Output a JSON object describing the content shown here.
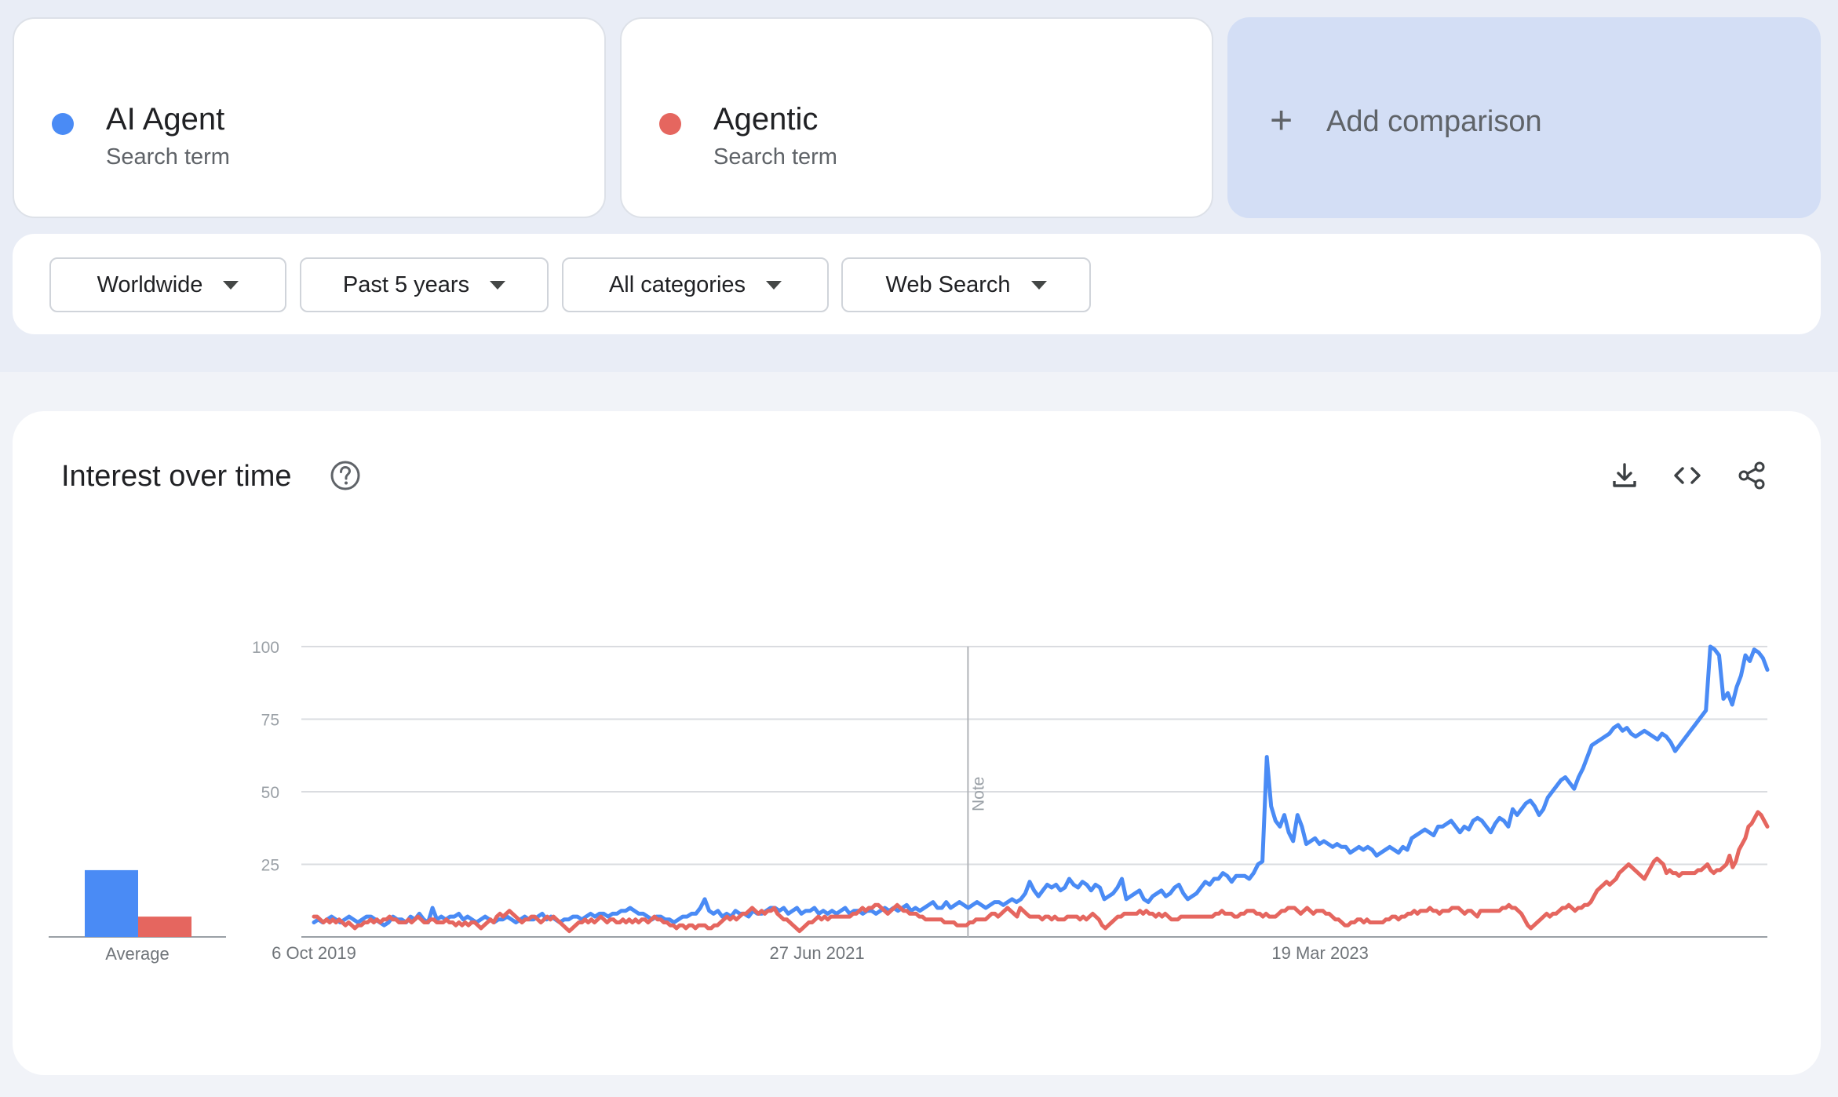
{
  "search_terms": [
    {
      "name": "AI Agent",
      "subtitle": "Search term",
      "color": "#4a8bf5"
    },
    {
      "name": "Agentic",
      "subtitle": "Search term",
      "color": "#e5665f"
    }
  ],
  "add_comparison": {
    "icon": "plus-icon",
    "label": "Add comparison"
  },
  "filters": {
    "region": "Worldwide",
    "time_range": "Past 5 years",
    "category": "All categories",
    "search_type": "Web Search"
  },
  "panel": {
    "title": "Interest over time",
    "help_icon": "help-circle-icon",
    "toolbar_icons": [
      "download-icon",
      "embed-code-icon",
      "share-icon"
    ]
  },
  "chart_data": {
    "type": "line",
    "ylim": [
      0,
      100
    ],
    "y_ticks": [
      "25",
      "50",
      "75",
      "100"
    ],
    "x_tick_labels": [
      "6 Oct 2019",
      "27 Jun 2021",
      "19 Mar 2023"
    ],
    "note_label": "Note",
    "average": {
      "label": "Average",
      "values": [
        {
          "series": "AI Agent",
          "value": 23
        },
        {
          "series": "Agentic",
          "value": 7
        }
      ]
    },
    "weeks": 261,
    "series": [
      {
        "name": "AI Agent",
        "color": "#4a8bf5",
        "values": [
          5,
          6,
          5,
          6,
          7,
          6,
          5,
          6,
          7,
          6,
          5,
          6,
          7,
          7,
          6,
          5,
          4,
          5,
          7,
          6,
          6,
          5,
          7,
          6,
          8,
          6,
          5,
          10,
          6,
          7,
          6,
          7,
          7,
          8,
          6,
          7,
          6,
          5,
          6,
          7,
          6,
          5,
          6,
          6,
          7,
          6,
          5,
          6,
          7,
          6,
          6,
          7,
          8,
          6,
          7,
          6,
          5,
          6,
          6,
          7,
          7,
          6,
          7,
          8,
          7,
          8,
          8,
          7,
          8,
          8,
          9,
          9,
          10,
          9,
          8,
          8,
          7,
          6,
          7,
          7,
          6,
          6,
          5,
          6,
          7,
          7,
          8,
          8,
          10,
          13,
          9,
          8,
          9,
          7,
          8,
          7,
          9,
          8,
          8,
          7,
          9,
          8,
          8,
          9,
          10,
          10,
          9,
          10,
          8,
          9,
          10,
          8,
          9,
          9,
          10,
          8,
          9,
          8,
          9,
          8,
          9,
          10,
          8,
          9,
          9,
          8,
          9,
          9,
          8,
          9,
          10,
          9,
          10,
          9,
          10,
          11,
          9,
          10,
          9,
          10,
          11,
          12,
          10,
          10,
          12,
          10,
          11,
          12,
          11,
          10,
          11,
          12,
          11,
          10,
          11,
          12,
          12,
          11,
          12,
          13,
          12,
          13,
          15,
          19,
          16,
          14,
          16,
          18,
          17,
          18,
          16,
          17,
          20,
          18,
          17,
          19,
          18,
          16,
          18,
          17,
          13,
          14,
          15,
          17,
          20,
          13,
          14,
          15,
          16,
          13,
          12,
          14,
          15,
          16,
          14,
          15,
          17,
          18,
          15,
          13,
          14,
          15,
          17,
          19,
          18,
          20,
          20,
          22,
          21,
          19,
          21,
          21,
          21,
          20,
          22,
          25,
          26,
          62,
          45,
          40,
          38,
          42,
          36,
          33,
          42,
          38,
          32,
          33,
          34,
          32,
          33,
          32,
          31,
          32,
          31,
          31,
          29,
          30,
          31,
          30,
          31,
          30,
          28,
          29,
          30,
          31,
          30,
          29,
          31,
          30,
          34,
          35,
          36,
          37,
          36,
          35,
          38,
          38,
          39,
          40,
          38,
          36,
          38,
          37,
          40,
          41,
          40,
          38,
          36,
          39,
          41,
          40,
          38,
          44,
          42,
          44,
          46,
          47,
          45,
          42,
          44,
          48,
          50,
          52,
          54,
          55,
          53,
          51,
          55,
          58,
          62,
          66,
          67,
          68,
          69,
          70,
          72,
          73,
          71,
          72,
          70,
          69,
          70,
          71,
          70,
          69,
          68,
          70,
          69,
          67,
          64,
          66,
          68,
          70,
          72,
          74,
          76,
          78,
          100,
          99,
          97,
          82,
          84,
          80,
          86,
          90,
          97,
          95,
          99,
          98,
          96,
          92
        ]
      },
      {
        "name": "Agentic",
        "color": "#e5665f",
        "values": [
          7,
          7,
          6,
          5,
          6,
          5,
          6,
          5,
          6,
          5,
          4,
          5,
          4,
          3,
          4,
          4,
          5,
          5,
          6,
          5,
          6,
          5,
          6,
          6,
          7,
          6,
          6,
          5,
          5,
          5,
          6,
          5,
          6,
          7,
          6,
          5,
          5,
          6,
          6,
          5,
          5,
          5,
          6,
          5,
          5,
          4,
          5,
          4,
          5,
          4,
          5,
          5,
          4,
          3,
          4,
          5,
          6,
          5,
          7,
          8,
          7,
          8,
          9,
          8,
          7,
          6,
          5,
          6,
          6,
          7,
          7,
          6,
          5,
          6,
          7,
          6,
          7,
          6,
          5,
          4,
          3,
          2,
          3,
          4,
          5,
          5,
          6,
          5,
          6,
          5,
          6,
          7,
          6,
          5,
          6,
          6,
          5,
          5,
          6,
          5,
          6,
          5,
          6,
          5,
          6,
          6,
          5,
          6,
          7,
          6,
          6,
          5,
          5,
          4,
          4,
          3,
          4,
          4,
          3,
          4,
          4,
          3,
          4,
          4,
          4,
          3,
          3,
          4,
          4,
          5,
          6,
          7,
          6,
          7,
          6,
          7,
          8,
          8,
          9,
          10,
          9,
          8,
          9,
          8,
          9,
          9,
          10,
          8,
          7,
          6,
          6,
          5,
          4,
          3,
          2,
          3,
          4,
          5,
          5,
          6,
          7,
          6,
          7,
          6,
          7,
          7,
          7,
          7,
          7,
          7,
          7,
          8,
          8,
          9,
          10,
          9,
          10,
          10,
          11,
          11,
          10,
          9,
          8,
          9,
          10,
          11,
          10,
          9,
          9,
          8,
          8,
          8,
          7,
          7,
          6,
          6,
          6,
          6,
          6,
          6,
          5,
          5,
          5,
          5,
          4,
          4,
          4,
          4,
          5,
          5,
          6,
          6,
          6,
          6,
          7,
          8,
          8,
          7,
          8,
          9,
          10,
          9,
          8,
          7,
          10,
          9,
          8,
          7,
          7,
          7,
          7,
          6,
          7,
          7,
          6,
          7,
          6,
          6,
          6,
          7,
          7,
          7,
          7,
          6,
          7,
          6,
          7,
          8,
          7,
          6,
          4,
          3,
          4,
          5,
          6,
          7,
          7,
          8,
          8,
          8,
          8,
          8,
          9,
          8,
          9,
          8,
          8,
          7,
          8,
          7,
          8,
          7,
          6,
          6,
          6,
          7,
          7,
          7,
          7,
          7,
          7,
          7,
          7,
          7,
          7,
          7,
          8,
          8,
          9,
          8,
          8,
          8,
          7,
          7,
          8,
          8,
          9,
          9,
          9,
          8,
          8,
          7,
          8,
          7,
          7,
          7,
          8,
          9,
          9,
          10,
          10,
          10,
          9,
          8,
          9,
          10,
          9,
          8,
          9,
          9,
          9,
          8,
          8,
          7,
          6,
          6,
          5,
          4,
          4,
          5,
          5,
          6,
          6,
          5,
          6,
          5,
          5,
          5,
          5,
          5,
          6,
          6,
          7,
          7,
          6,
          7,
          7,
          8,
          8,
          9,
          8,
          9,
          9,
          9,
          10,
          9,
          9,
          8,
          9,
          9,
          9,
          10,
          10,
          10,
          9,
          8,
          9,
          9,
          8,
          7,
          9,
          9,
          9,
          9,
          9,
          9,
          9,
          10,
          10,
          11,
          10,
          10,
          9,
          8,
          6,
          4,
          3,
          4,
          5,
          6,
          7,
          8,
          7,
          8,
          8,
          9,
          10,
          10,
          11,
          10,
          9,
          10,
          10,
          11,
          11,
          12,
          14,
          16,
          17,
          18,
          19,
          18,
          19,
          20,
          22,
          23,
          24,
          25,
          24,
          23,
          22,
          21,
          20,
          22,
          24,
          26,
          27,
          26,
          25,
          22,
          23,
          22,
          22,
          21,
          22,
          22,
          22,
          22,
          22,
          23,
          23,
          24,
          25,
          23,
          22,
          23,
          23,
          24,
          25,
          28,
          24,
          26,
          30,
          32,
          34,
          38,
          39,
          41,
          43,
          42,
          40,
          38
        ]
      }
    ]
  }
}
